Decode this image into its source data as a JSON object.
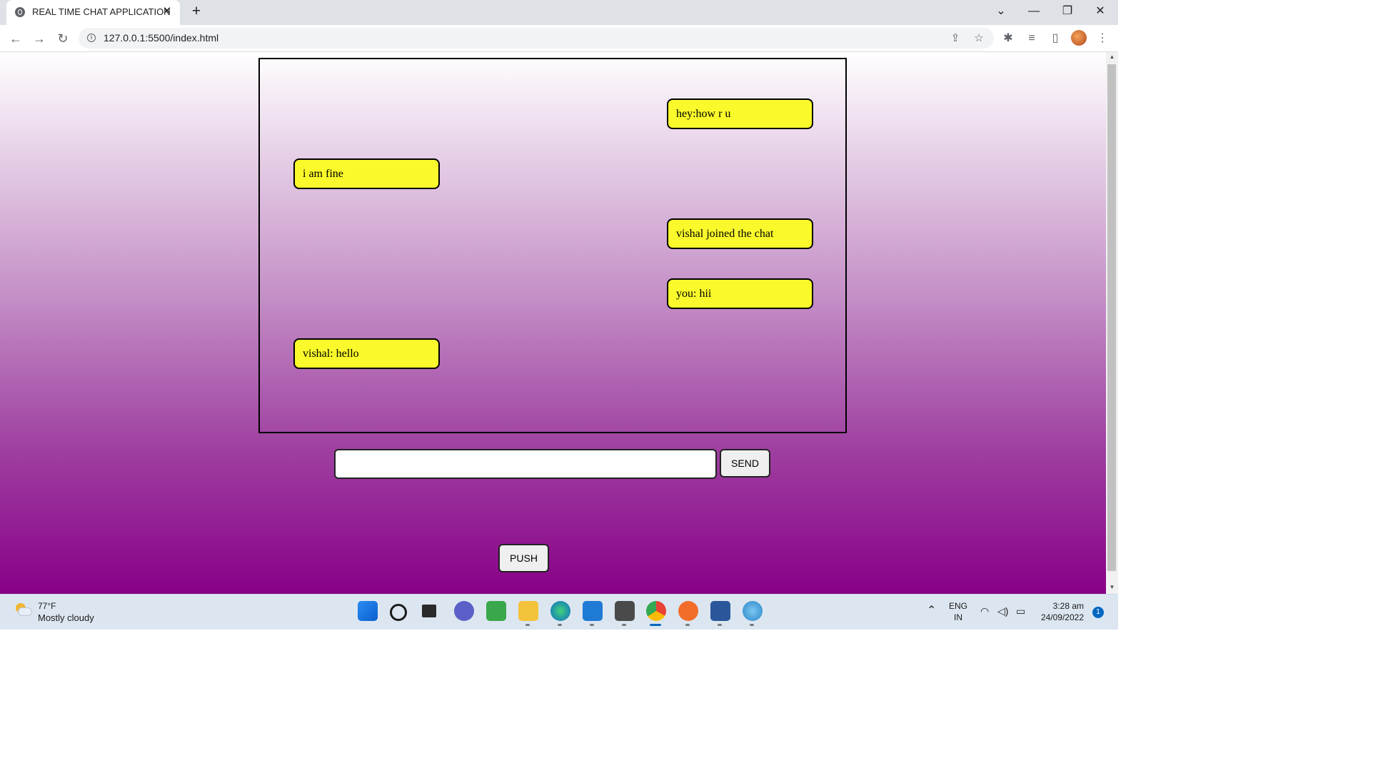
{
  "browser": {
    "tab_title": "REAL TIME CHAT APPLICATION",
    "new_tab_icon": "plus-icon",
    "url": "127.0.0.1:5500/index.html"
  },
  "chat": {
    "messages": [
      {
        "text": "hey:how r u",
        "side": "right"
      },
      {
        "text": "i am fine",
        "side": "left"
      },
      {
        "text": "vishal joined the chat",
        "side": "right"
      },
      {
        "text": "you: hii",
        "side": "right"
      },
      {
        "text": "vishal: hello",
        "side": "left"
      }
    ],
    "input_value": "",
    "send_label": "SEND",
    "push_label": "PUSH"
  },
  "taskbar": {
    "temperature": "77°F",
    "condition": "Mostly cloudy",
    "language": "ENG",
    "region": "IN",
    "time": "3:28 am",
    "date": "24/09/2022",
    "notification_count": "1"
  },
  "colors": {
    "bubble": "#f9f92b",
    "gradient_top": "#ffffff",
    "gradient_bottom": "#880088"
  }
}
